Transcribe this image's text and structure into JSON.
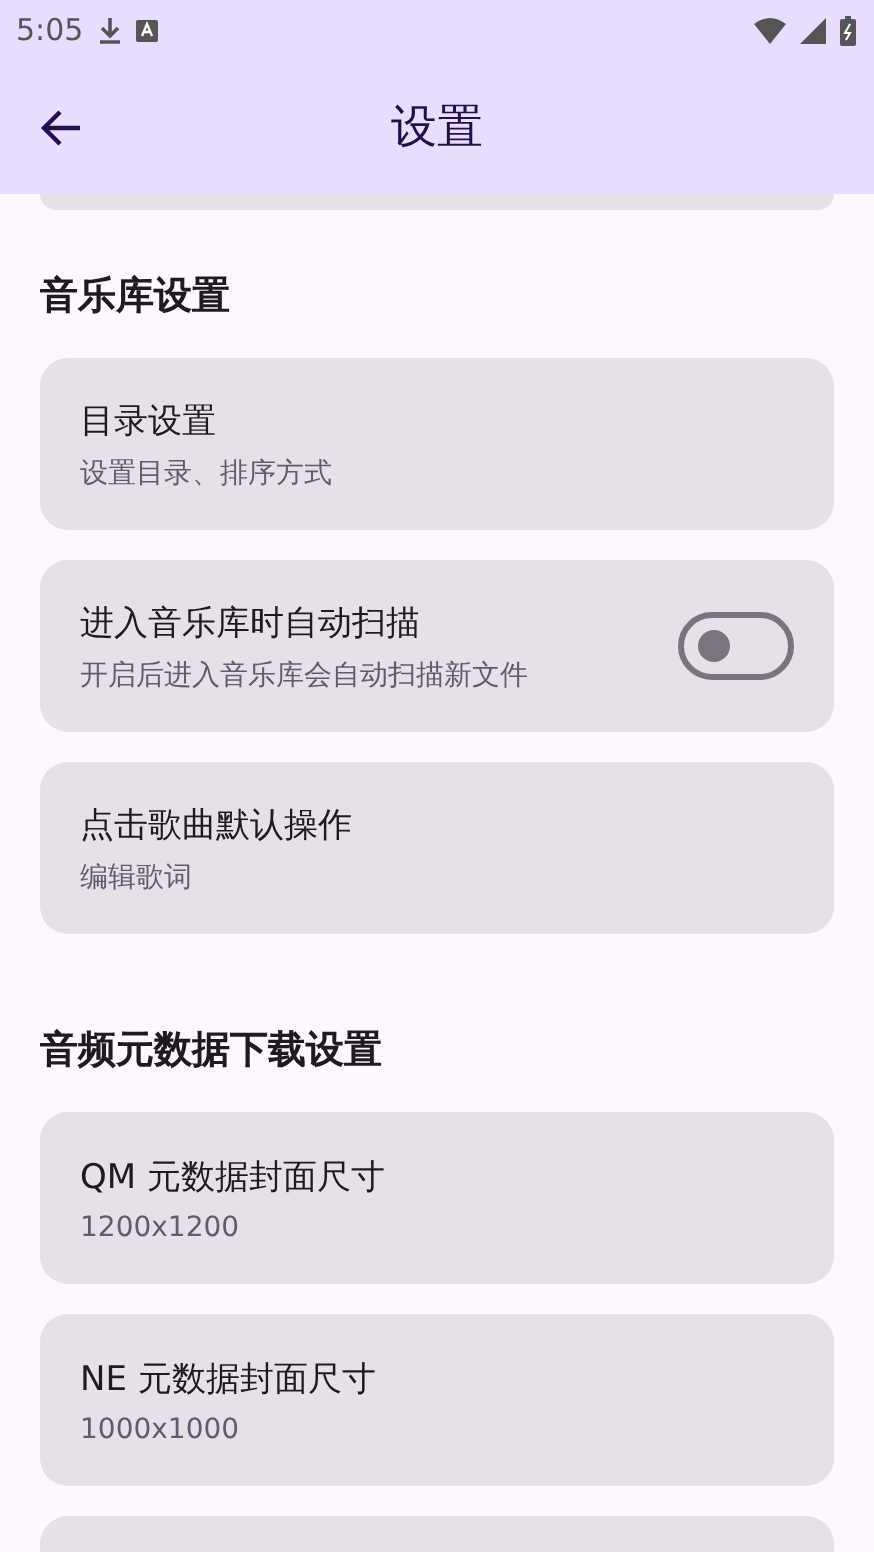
{
  "status_bar": {
    "time": "5:05"
  },
  "app_bar": {
    "title": "设置"
  },
  "sections": [
    {
      "header": "音乐库设置",
      "items": [
        {
          "kind": "text",
          "title": "目录设置",
          "subtitle": "设置目录、排序方式"
        },
        {
          "kind": "switch",
          "title": "进入音乐库时自动扫描",
          "subtitle": "开启后进入音乐库会自动扫描新文件",
          "on": false
        },
        {
          "kind": "text",
          "title": "点击歌曲默认操作",
          "subtitle": "编辑歌词"
        }
      ]
    },
    {
      "header": "音频元数据下载设置",
      "items": [
        {
          "kind": "text",
          "title": "QM 元数据封面尺寸",
          "subtitle": "1200x1200"
        },
        {
          "kind": "text",
          "title": "NE 元数据封面尺寸",
          "subtitle": "1000x1000"
        }
      ]
    }
  ]
}
